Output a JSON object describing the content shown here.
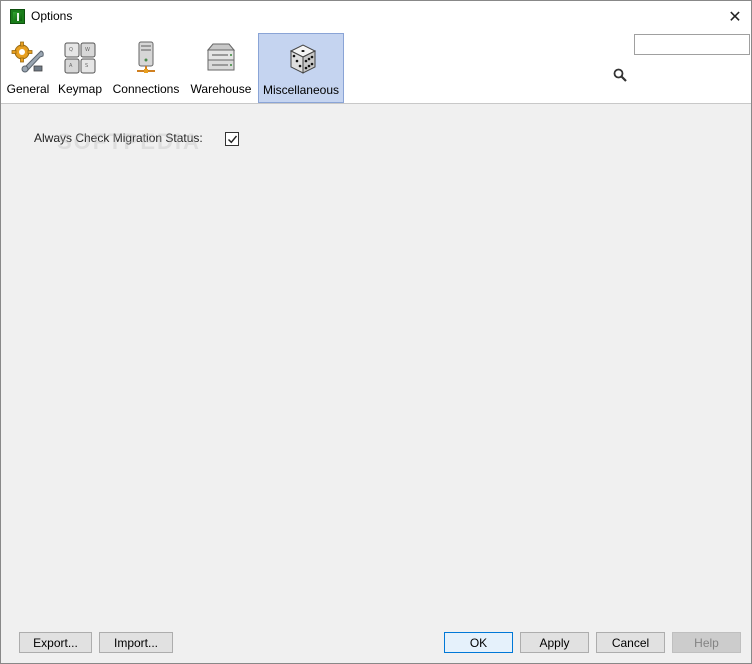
{
  "window": {
    "title": "Options",
    "close_glyph": "✕"
  },
  "toolbar": {
    "categories": [
      {
        "label": "General",
        "icon": "gears-wrench-icon"
      },
      {
        "label": "Keymap",
        "icon": "keyboard-keys-icon"
      },
      {
        "label": "Connections",
        "icon": "server-network-icon"
      },
      {
        "label": "Warehouse",
        "icon": "storage-drive-icon"
      },
      {
        "label": "Miscellaneous",
        "icon": "dice-icon",
        "selected": true
      }
    ]
  },
  "search": {
    "value": "",
    "placeholder": ""
  },
  "content": {
    "watermark": "SOFTPEDIA",
    "options": [
      {
        "label": "Always Check Migration Status:",
        "checked": true
      }
    ]
  },
  "buttons": {
    "export": "Export...",
    "import": "Import...",
    "ok": "OK",
    "apply": "Apply",
    "cancel": "Cancel",
    "help": "Help"
  },
  "colors": {
    "selected_bg": "#c5d4f0",
    "selected_border": "#8aa4d6",
    "default_button_border": "#0078d7"
  }
}
